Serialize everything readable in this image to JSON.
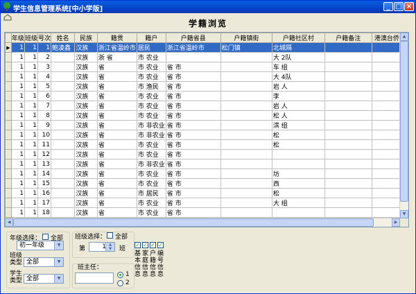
{
  "window": {
    "title": "学生信息管理系统[中小学版]",
    "min_label": "_",
    "max_label": "□",
    "close_label": "×"
  },
  "page": {
    "title": "学籍浏览"
  },
  "grid": {
    "columns": [
      "年级",
      "班级",
      "号次",
      "姓名",
      "民族",
      "籍贯",
      "籍户",
      "户籍省县",
      "户籍镇街",
      "户籍社区村",
      "户籍备注",
      "港澳台侨外"
    ],
    "rows": [
      [
        "1",
        "1",
        "1",
        "鲍凌鑫",
        "汉族",
        "浙江省温岭市",
        "居民",
        "浙江省温岭市",
        "松门镇",
        "北城隔",
        "",
        ""
      ],
      [
        "1",
        "1",
        "2",
        "",
        "汉族",
        "浙 省",
        "市 农业",
        "",
        "",
        "大 2队",
        "",
        ""
      ],
      [
        "1",
        "1",
        "3",
        "",
        "汉族",
        "省",
        "市 农业",
        "省 市",
        "",
        "车 组",
        "",
        ""
      ],
      [
        "1",
        "1",
        "4",
        "",
        "汉族",
        "省",
        "市 农业",
        "省 市",
        "",
        "大 4队",
        "",
        ""
      ],
      [
        "1",
        "1",
        "5",
        "",
        "汉族",
        "省",
        "市 渔民",
        "省 市",
        "",
        "岩 人",
        "",
        ""
      ],
      [
        "1",
        "1",
        "6",
        "",
        "汉族",
        "省",
        "市 农业",
        "省 市",
        "",
        "李",
        "",
        ""
      ],
      [
        "1",
        "1",
        "7",
        "",
        "汉族",
        "省",
        "市 农业",
        "省 市",
        "",
        "岩 人",
        "",
        ""
      ],
      [
        "1",
        "1",
        "8",
        "",
        "汉族",
        "省",
        "市 农业",
        "省 市",
        "",
        "松 人",
        "",
        ""
      ],
      [
        "1",
        "1",
        "9",
        "",
        "汉族",
        "省",
        "市 非农业",
        "省 市",
        "",
        "滨 组",
        "",
        ""
      ],
      [
        "1",
        "1",
        "10",
        "",
        "汉族",
        "省",
        "市 非农业",
        "省 市",
        "",
        "松",
        "",
        ""
      ],
      [
        "1",
        "1",
        "11",
        "",
        "汉族",
        "省",
        "市 农业",
        "省 市",
        "",
        "松",
        "",
        ""
      ],
      [
        "1",
        "1",
        "12",
        "",
        "汉族",
        "省",
        "市 农业",
        "省 市",
        "",
        "",
        "",
        ""
      ],
      [
        "1",
        "1",
        "13",
        "",
        "汉族",
        "省",
        "市 非农业",
        "省 市",
        "",
        "",
        "",
        ""
      ],
      [
        "1",
        "1",
        "14",
        "",
        "汉族",
        "省",
        "市 农业",
        "省 市",
        "",
        "坊",
        "",
        ""
      ],
      [
        "1",
        "1",
        "15",
        "",
        "汉族",
        "省",
        "市 农业",
        "省 市",
        "",
        "西",
        "",
        ""
      ],
      [
        "1",
        "1",
        "16",
        "",
        "汉族",
        "省",
        "市 居民",
        "省 市",
        "",
        "松",
        "",
        ""
      ],
      [
        "1",
        "1",
        "17",
        "",
        "汉族",
        "省",
        "市 农业",
        "省 市",
        "",
        "大 组",
        "",
        ""
      ],
      [
        "1",
        "1",
        "18",
        "",
        "汉族",
        "省",
        "市 农业",
        "省 市",
        "",
        "",
        "",
        ""
      ]
    ]
  },
  "filters": {
    "grade_label": "年级选择：",
    "grade_all_label": "全部",
    "grade_value": "初一年级",
    "class_type_label": "班级类型",
    "class_type_value": "全部",
    "student_type_label": "学生类型",
    "student_type_value": "全部",
    "class_label": "班级选择：",
    "class_all_label": "全部",
    "class_prefix": "第",
    "class_value": "1",
    "class_suffix": "班",
    "teacher_label": "班主任：",
    "teacher_value": "",
    "radio1_label": "1",
    "radio2_label": "2"
  },
  "checkboxes": [
    {
      "label": "基本信息",
      "checked": true
    },
    {
      "label": "家庭信息",
      "checked": true
    },
    {
      "label": "户籍信息",
      "checked": true
    },
    {
      "label": "编号信息",
      "checked": true
    }
  ]
}
